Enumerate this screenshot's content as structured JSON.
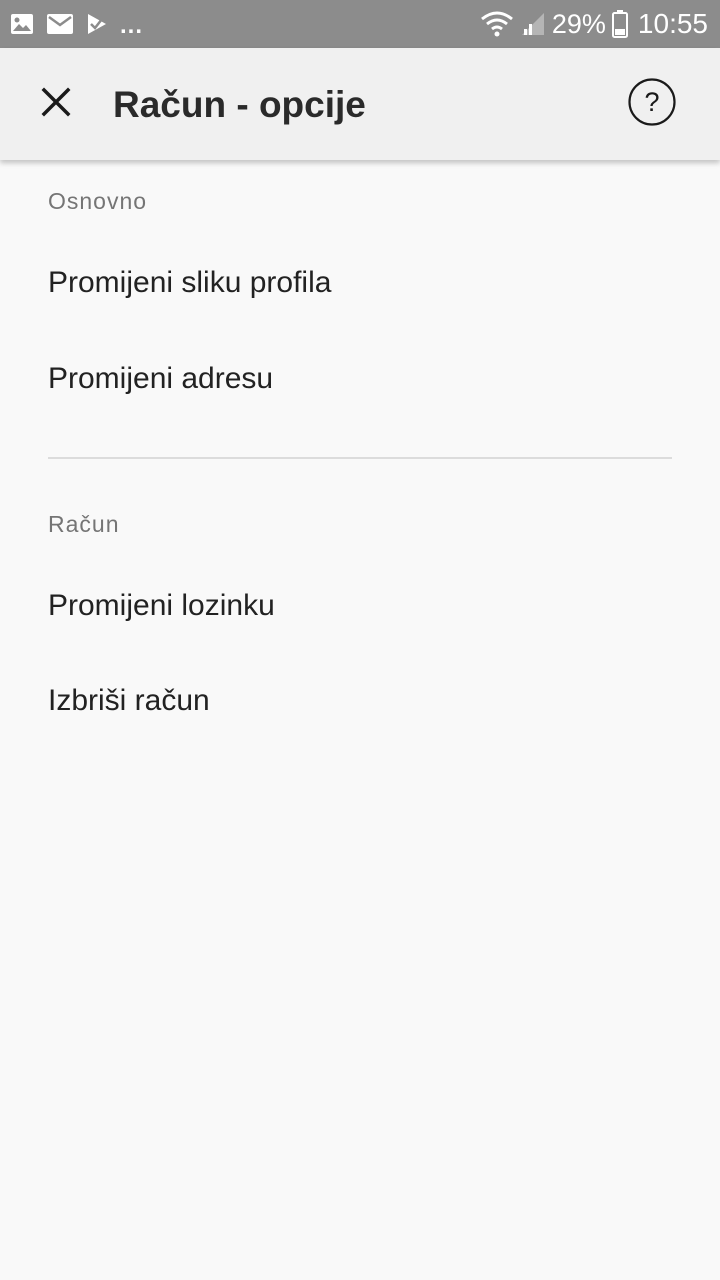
{
  "status_bar": {
    "notification_icons": [
      "image-icon",
      "mail-icon",
      "check-app-icon"
    ],
    "overflow_dots": "...",
    "battery_percent": "29%",
    "time": "10:55"
  },
  "app_bar": {
    "title": "Račun - opcije",
    "close_icon": "close-icon",
    "help_icon": "help-icon"
  },
  "sections": [
    {
      "header": "Osnovno",
      "items": [
        "Promijeni sliku profila",
        "Promijeni adresu"
      ]
    },
    {
      "header": "Račun",
      "items": [
        "Promijeni lozinku",
        "Izbriši račun"
      ]
    }
  ]
}
